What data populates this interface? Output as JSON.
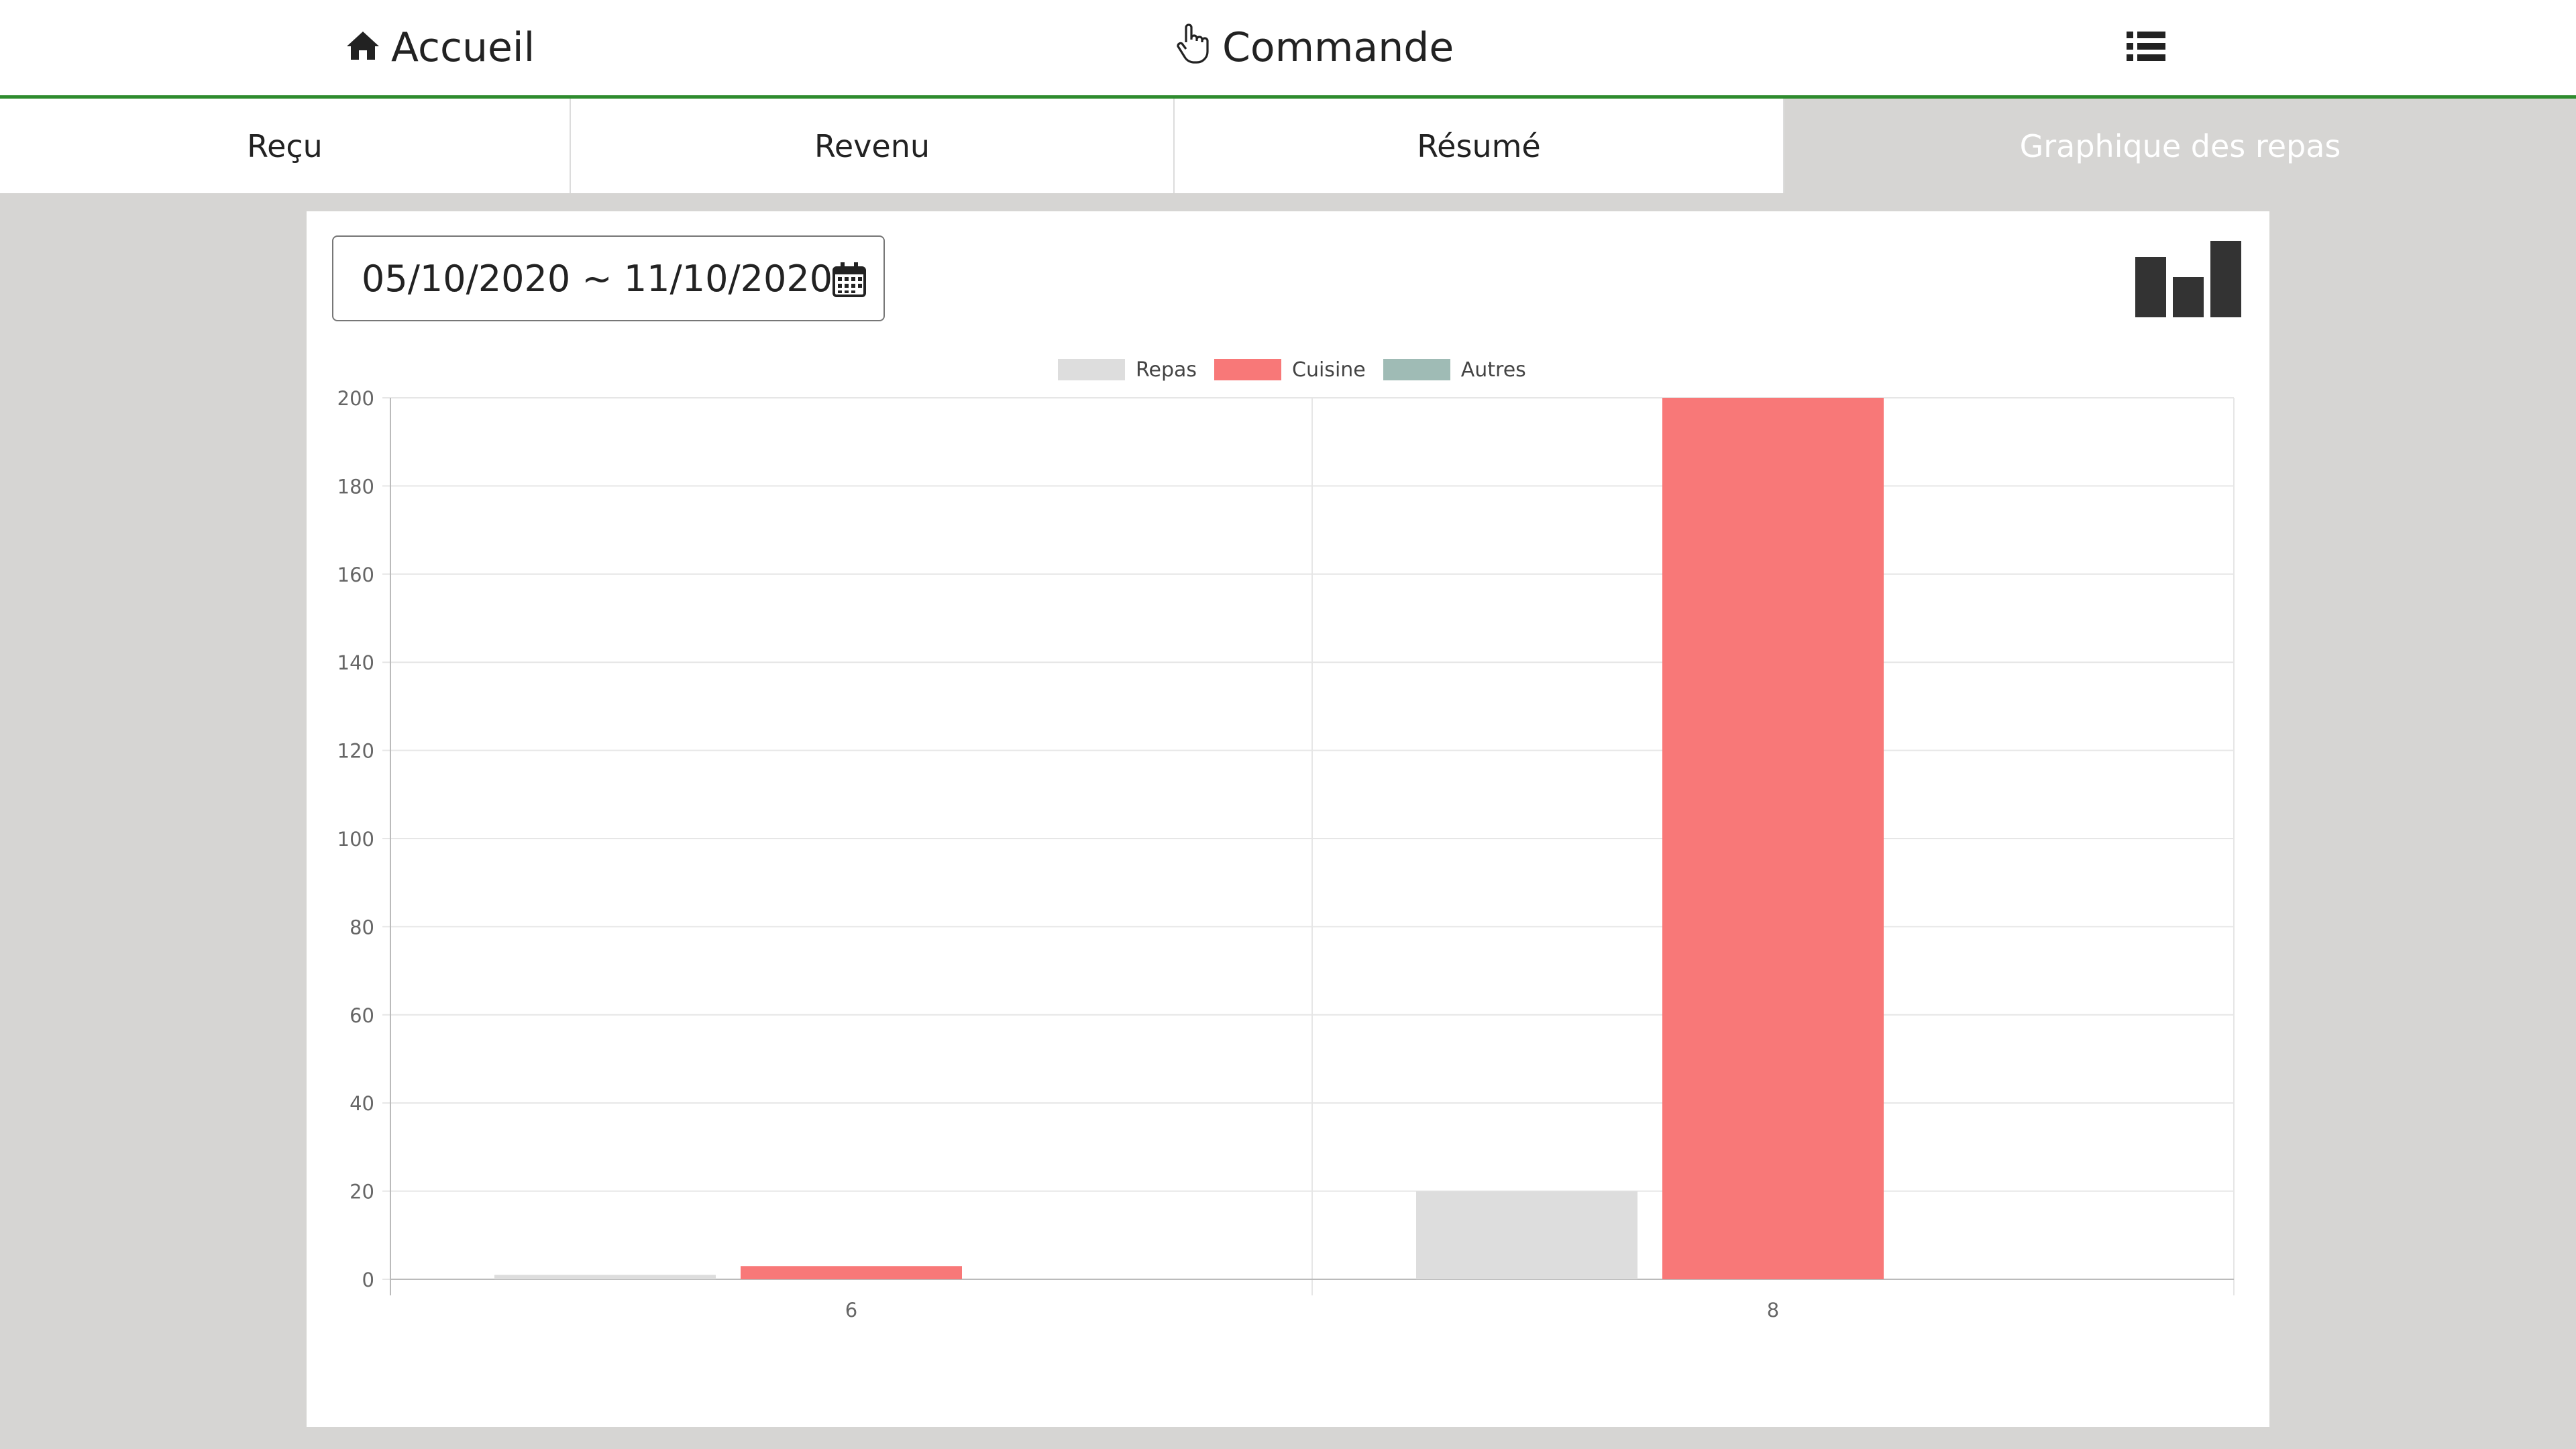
{
  "nav": {
    "home_label": "Accueil",
    "order_label": "Commande"
  },
  "tabs": [
    {
      "label": "Reçu"
    },
    {
      "label": "Revenu"
    },
    {
      "label": "Résumé"
    },
    {
      "label": "Graphique des repas",
      "active": true
    }
  ],
  "filter": {
    "date_range": "05/10/2020 ~ 11/10/2020"
  },
  "chart_data": {
    "type": "bar",
    "categories": [
      "6",
      "8"
    ],
    "series": [
      {
        "name": "Repas",
        "values": [
          1,
          20
        ],
        "color": "#dddddd"
      },
      {
        "name": "Cuisine",
        "values": [
          3,
          200
        ],
        "color": "#f87878"
      },
      {
        "name": "Autres",
        "values": [
          0,
          0
        ],
        "color": "#9fbbb5"
      }
    ],
    "ylim": [
      0,
      200
    ],
    "yticks": [
      0,
      20,
      40,
      60,
      80,
      100,
      120,
      140,
      160,
      180,
      200
    ],
    "legend": "top",
    "grid": true
  },
  "colors": {
    "accent": "#2e8b2e",
    "background": "#d6d5d3"
  }
}
